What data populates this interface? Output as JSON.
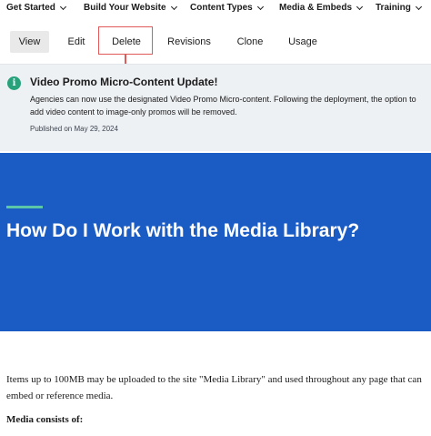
{
  "nav": {
    "items": [
      {
        "label": "Get Started"
      },
      {
        "label": "Build Your Website"
      },
      {
        "label": "Content Types"
      },
      {
        "label": "Media & Embeds"
      },
      {
        "label": "Training"
      }
    ]
  },
  "tabs": [
    {
      "label": "View",
      "active": true
    },
    {
      "label": "Edit"
    },
    {
      "label": "Delete"
    },
    {
      "label": "Revisions"
    },
    {
      "label": "Clone"
    },
    {
      "label": "Usage"
    }
  ],
  "alert": {
    "icon": "info-icon",
    "icon_glyph": "i",
    "title": "Video Promo Micro-Content Update!",
    "body": "Agencies can now use the designated Video Promo Micro-content. Following the deployment, the option to add video content to image-only promos will be removed.",
    "date": "Published on May 29, 2024"
  },
  "hero": {
    "title": "How Do I Work with the Media Library?"
  },
  "content": {
    "paragraph": "Items up to 100MB may be uploaded to the site \"Media Library\" and used throughout any page that can embed or reference media.",
    "subhead": "Media consists of:"
  },
  "colors": {
    "hero_bg": "#1a5cc4",
    "accent_bar": "#5cc6a8",
    "info_icon": "#27a27b",
    "highlight": "#e05a5a"
  }
}
